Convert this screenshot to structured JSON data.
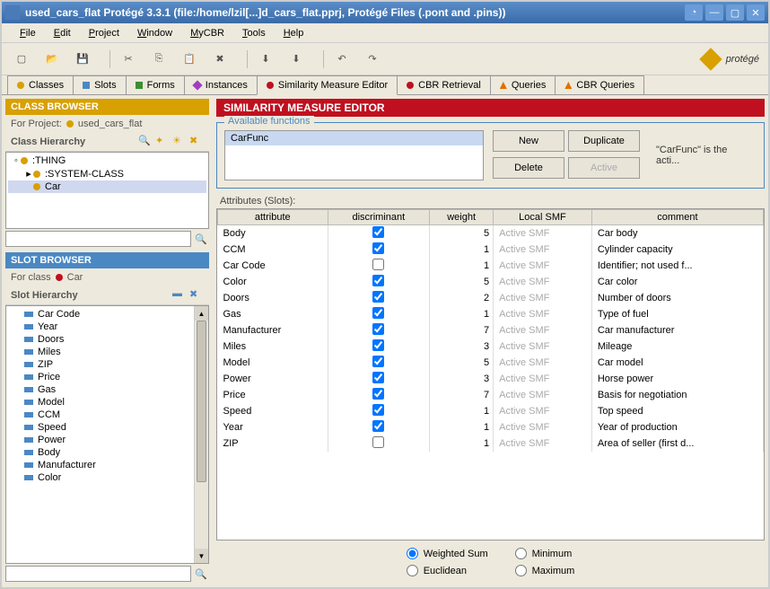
{
  "window": {
    "title": "used_cars_flat  Protégé 3.3.1    (file:/home/lzil[...]d_cars_flat.pprj, Protégé Files (.pont and .pins))"
  },
  "menu": [
    "File",
    "Edit",
    "Project",
    "Window",
    "MyCBR",
    "Tools",
    "Help"
  ],
  "logo_text": "protégé",
  "tabs": [
    {
      "label": "Classes",
      "color": "#d8a000",
      "shape": "dot"
    },
    {
      "label": "Slots",
      "color": "#4a88c4",
      "shape": "sq"
    },
    {
      "label": "Forms",
      "color": "#3a9030",
      "shape": "sq"
    },
    {
      "label": "Instances",
      "color": "#a040c0",
      "shape": "diamond"
    },
    {
      "label": "Similarity Measure Editor",
      "color": "#c01020",
      "shape": "dot",
      "active": true
    },
    {
      "label": "CBR Retrieval",
      "color": "#c01020",
      "shape": "dot"
    },
    {
      "label": "Queries",
      "color": "#e07000",
      "shape": "tri"
    },
    {
      "label": "CBR Queries",
      "color": "#e07000",
      "shape": "tri"
    }
  ],
  "class_browser": {
    "title": "CLASS BROWSER",
    "for_project": "For Project:",
    "project_name": "used_cars_flat",
    "hierarchy_label": "Class Hierarchy",
    "tree": [
      {
        "label": ":THING",
        "indent": 0,
        "color": "#d8a000",
        "open": true
      },
      {
        "label": ":SYSTEM-CLASS",
        "indent": 1,
        "color": "#d8a000",
        "closed": true
      },
      {
        "label": "Car",
        "indent": 1,
        "color": "#d8a000",
        "selected": true
      }
    ]
  },
  "slot_browser": {
    "title": "SLOT BROWSER",
    "for_class": "For class",
    "class_name": "Car",
    "hierarchy_label": "Slot Hierarchy",
    "items": [
      "Car Code",
      "Year",
      "Doors",
      "Miles",
      "ZIP",
      "Price",
      "Gas",
      "Model",
      "CCM",
      "Speed",
      "Power",
      "Body",
      "Manufacturer",
      "Color"
    ]
  },
  "editor": {
    "title": "SIMILARITY MEASURE EDITOR",
    "functions_label": "Available functions",
    "functions": [
      "CarFunc"
    ],
    "buttons": {
      "new": "New",
      "duplicate": "Duplicate",
      "delete": "Delete",
      "active": "Active"
    },
    "status": "\"CarFunc\" is the acti...",
    "attr_label": "Attributes (Slots):",
    "columns": [
      "attribute",
      "discriminant",
      "weight",
      "Local SMF",
      "comment"
    ],
    "rows": [
      {
        "attr": "Body",
        "disc": true,
        "weight": 5,
        "smf": "Active SMF",
        "comment": "Car body"
      },
      {
        "attr": "CCM",
        "disc": true,
        "weight": 1,
        "smf": "Active SMF",
        "comment": "Cylinder capacity"
      },
      {
        "attr": "Car Code",
        "disc": false,
        "weight": 1,
        "smf": "Active SMF",
        "comment": "Identifier; not used f..."
      },
      {
        "attr": "Color",
        "disc": true,
        "weight": 5,
        "smf": "Active SMF",
        "comment": "Car color"
      },
      {
        "attr": "Doors",
        "disc": true,
        "weight": 2,
        "smf": "Active SMF",
        "comment": "Number of doors"
      },
      {
        "attr": "Gas",
        "disc": true,
        "weight": 1,
        "smf": "Active SMF",
        "comment": "Type of fuel"
      },
      {
        "attr": "Manufacturer",
        "disc": true,
        "weight": 7,
        "smf": "Active SMF",
        "comment": "Car manufacturer"
      },
      {
        "attr": "Miles",
        "disc": true,
        "weight": 3,
        "smf": "Active SMF",
        "comment": "Mileage"
      },
      {
        "attr": "Model",
        "disc": true,
        "weight": 5,
        "smf": "Active SMF",
        "comment": "Car model"
      },
      {
        "attr": "Power",
        "disc": true,
        "weight": 3,
        "smf": "Active SMF",
        "comment": "Horse power"
      },
      {
        "attr": "Price",
        "disc": true,
        "weight": 7,
        "smf": "Active SMF",
        "comment": "Basis for negotiation"
      },
      {
        "attr": "Speed",
        "disc": true,
        "weight": 1,
        "smf": "Active SMF",
        "comment": "Top speed"
      },
      {
        "attr": "Year",
        "disc": true,
        "weight": 1,
        "smf": "Active SMF",
        "comment": "Year of production"
      },
      {
        "attr": "ZIP",
        "disc": false,
        "weight": 1,
        "smf": "Active SMF",
        "comment": "Area of seller (first d..."
      }
    ],
    "radios": {
      "weighted_sum": "Weighted Sum",
      "minimum": "Minimum",
      "euclidean": "Euclidean",
      "maximum": "Maximum"
    }
  }
}
